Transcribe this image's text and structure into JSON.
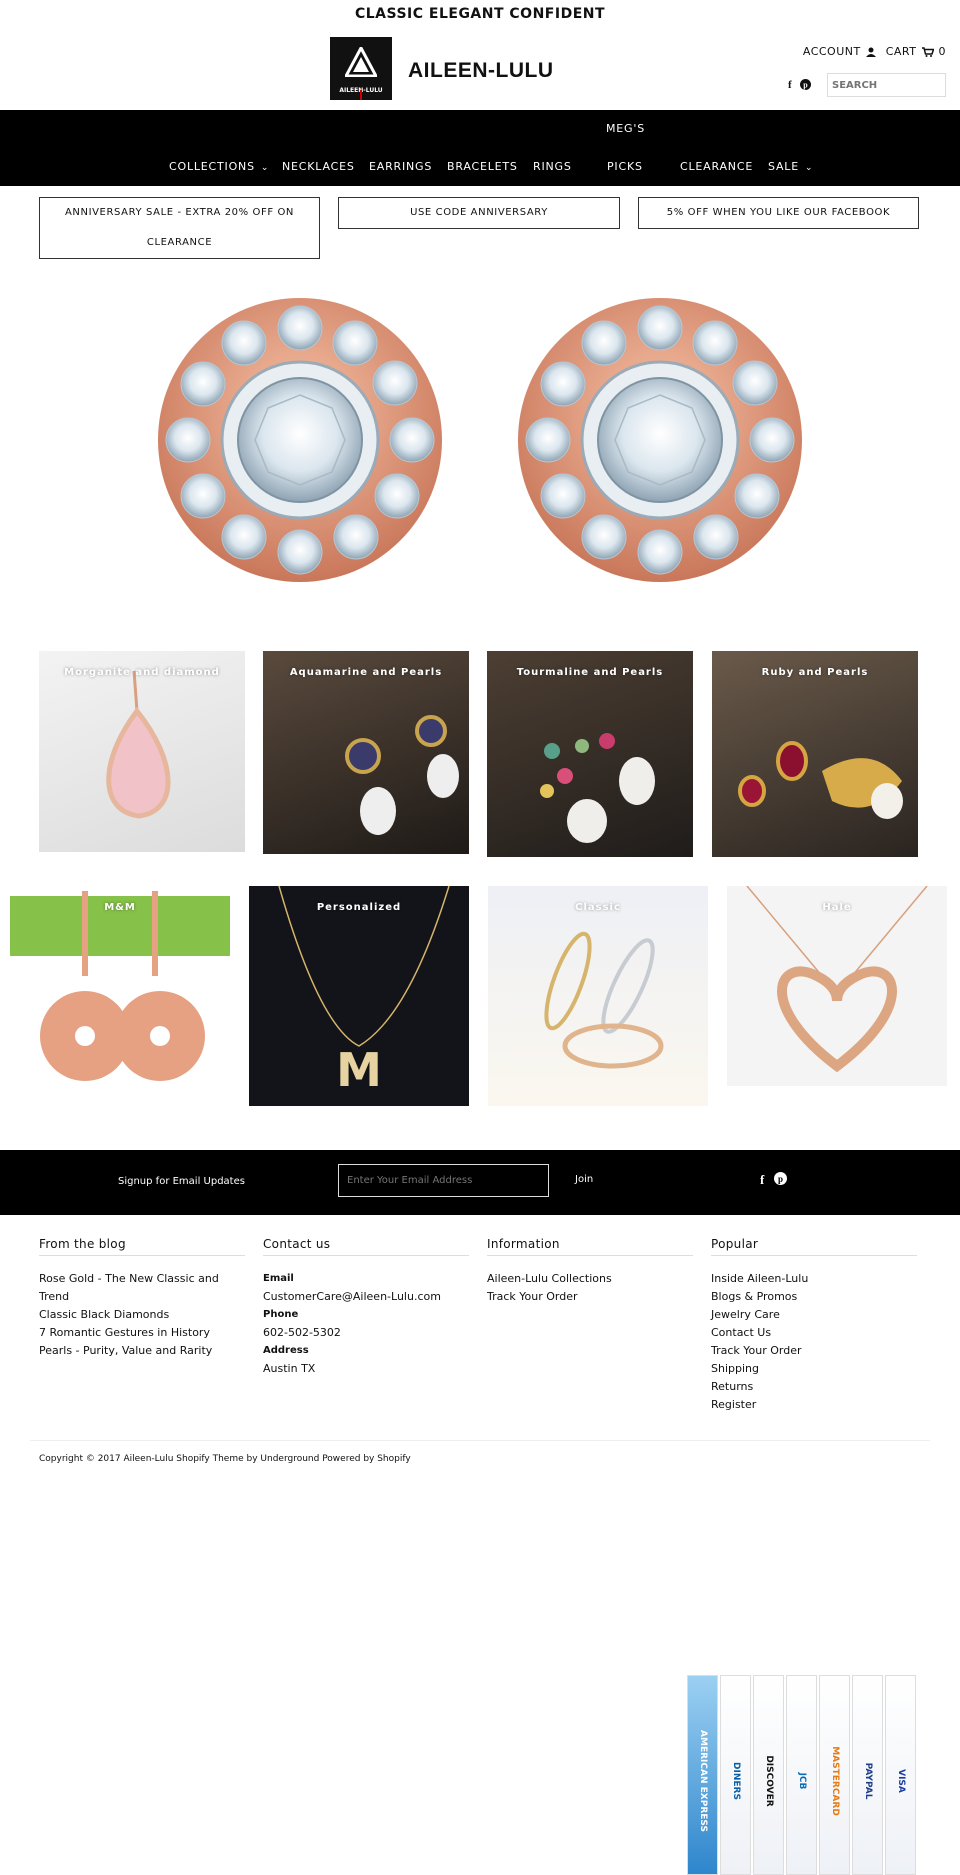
{
  "header": {
    "tagline": "CLASSIC ELEGANT CONFIDENT",
    "logo_text": "AILEEN-LULU",
    "brand": "AILEEN-LULU",
    "account_label": "ACCOUNT",
    "cart_label": "CART",
    "cart_count": "0",
    "search_placeholder": "SEARCH"
  },
  "nav": {
    "items": [
      {
        "label": "COLLECTIONS"
      },
      {
        "label": "NECKLACES"
      },
      {
        "label": "EARRINGS"
      },
      {
        "label": "BRACELETS"
      },
      {
        "label": "RINGS"
      },
      {
        "label": "MEG'S"
      },
      {
        "label": "PICKS"
      },
      {
        "label": "CLEARANCE"
      },
      {
        "label": "SALE"
      }
    ]
  },
  "promos": [
    {
      "line1": "ANNIVERSARY SALE - EXTRA 20% OFF ON",
      "line2": "CLEARANCE"
    },
    {
      "line1": "USE CODE ANNIVERSARY"
    },
    {
      "line1": "5% OFF WHEN YOU LIKE OUR FACEBOOK"
    }
  ],
  "collections_row1": [
    {
      "label": "Morganite and diamond"
    },
    {
      "label": "Aquamarine and Pearls"
    },
    {
      "label": "Tourmaline and Pearls"
    },
    {
      "label": "Ruby and Pearls"
    }
  ],
  "collections_row2": [
    {
      "label": "M&M"
    },
    {
      "label": "Personalized"
    },
    {
      "label": "Classic"
    },
    {
      "label": "Hale"
    }
  ],
  "newsletter": {
    "label": "Signup for Email Updates",
    "placeholder": "Enter Your Email Address",
    "join": "Join"
  },
  "footer": {
    "blog": {
      "heading": "From the blog",
      "items": [
        "Rose Gold - The New Classic and",
        "Trend",
        "Classic Black Diamonds",
        "7 Romantic Gestures in History",
        "Pearls - Purity, Value and Rarity"
      ]
    },
    "contact": {
      "heading": "Contact us",
      "email_label": "Email",
      "email": "CustomerCare@Aileen-Lulu.com",
      "phone_label": "Phone",
      "phone": "602-502-5302",
      "address_label": "Address",
      "address": "Austin TX"
    },
    "information": {
      "heading": "Information",
      "items": [
        "Aileen-Lulu Collections",
        "Track Your Order"
      ]
    },
    "popular": {
      "heading": "Popular",
      "items": [
        "Inside Aileen-Lulu",
        "Blogs & Promos",
        "Jewelry Care",
        "Contact Us",
        "Track Your Order",
        "Shipping",
        "Returns",
        "Register"
      ]
    },
    "copyright": "Copyright © 2017 Aileen-Lulu Shopify Theme by Underground Powered by Shopify"
  },
  "payments": [
    "AMERICAN EXPRESS",
    "DINERS",
    "DISCOVER",
    "JCB",
    "MASTERCARD",
    "PAYPAL",
    "VISA"
  ],
  "colors": {
    "nav_bg": "#000000",
    "text": "#111111",
    "rose_gold": "#e6a182"
  }
}
